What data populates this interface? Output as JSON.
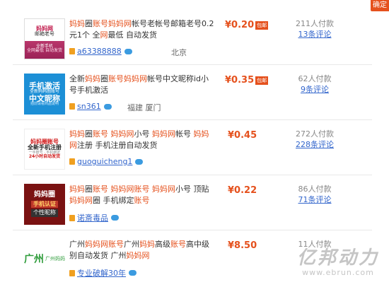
{
  "corner_tab": "确定",
  "rows": [
    {
      "thumb": [
        "妈妈网",
        "邮箱老号",
        "全新手机",
        "全网最低 自动发货"
      ],
      "title_html": "<span class=\"hl\">妈妈</span>圈<span class=\"hl\">账号</span><span class=\"hl\">妈妈网</span>帐号老帐号邮箱老号0.2元1个 全<span class=\"hl\">网</span>最低 自动发货",
      "seller": "a63388888",
      "location": "北京",
      "price": "¥0.20",
      "badge": "包邮",
      "paid": "211人付款",
      "reviews": "13条评论"
    },
    {
      "thumb": [
        "手机激活",
        "全新妈妈圈账号",
        "中文昵称",
        "拍前请看商品说明"
      ],
      "title_html": "全新<span class=\"hl\">妈妈</span>圈<span class=\"hl\">账号</span><span class=\"hl\">妈妈网</span>帐号中文昵称id小号手机激活",
      "seller": "sn361",
      "location": "福建 厦门",
      "price": "¥0.35",
      "badge": "包邮",
      "paid": "62人付款",
      "reviews": "9条评论"
    },
    {
      "thumb": [
        "妈妈圈账号",
        "全新手机注册",
        "一手账号 · 手机绑定",
        "24小时自动发货"
      ],
      "title_html": "<span class=\"hl\">妈妈</span>圈<span class=\"hl\">账号</span> <span class=\"hl\">妈妈网</span>小号 <span class=\"hl\">妈妈网</span>帐号 <span class=\"hl\">妈妈网</span>注册 手机注册自动发货",
      "seller": "guoguicheng1",
      "location": "",
      "price": "¥0.45",
      "badge": "",
      "paid": "272人付款",
      "reviews": "228条评论"
    },
    {
      "thumb": [
        "妈妈圈",
        "手机认证",
        "个性昵称"
      ],
      "title_html": "<span class=\"hl\">妈妈</span>圈<span class=\"hl\">账号</span> <span class=\"hl\">妈妈网账号</span> <span class=\"hl\">妈妈网</span>小号 顶贴 <span class=\"hl\">妈妈网</span>圈 手机绑定<span class=\"hl\">账号</span>",
      "seller": "诺斎毒品",
      "location": "",
      "price": "¥0.22",
      "badge": "",
      "paid": "86人付款",
      "reviews": "71条评论"
    },
    {
      "thumb": [
        "广州",
        "广州妈妈"
      ],
      "title_html": "广州<span class=\"hl\">妈妈网账号</span>广州<span class=\"hl\">妈妈</span>高级<span class=\"hl\">账号</span>高中级别自动发货 广州<span class=\"hl\">妈妈网</span>",
      "seller": "专业破解30年",
      "location": "",
      "price": "¥8.50",
      "badge": "",
      "paid": "11人付款",
      "reviews": ""
    }
  ],
  "watermark": {
    "main": "亿邦动力",
    "url": "www.ebrun.com"
  }
}
